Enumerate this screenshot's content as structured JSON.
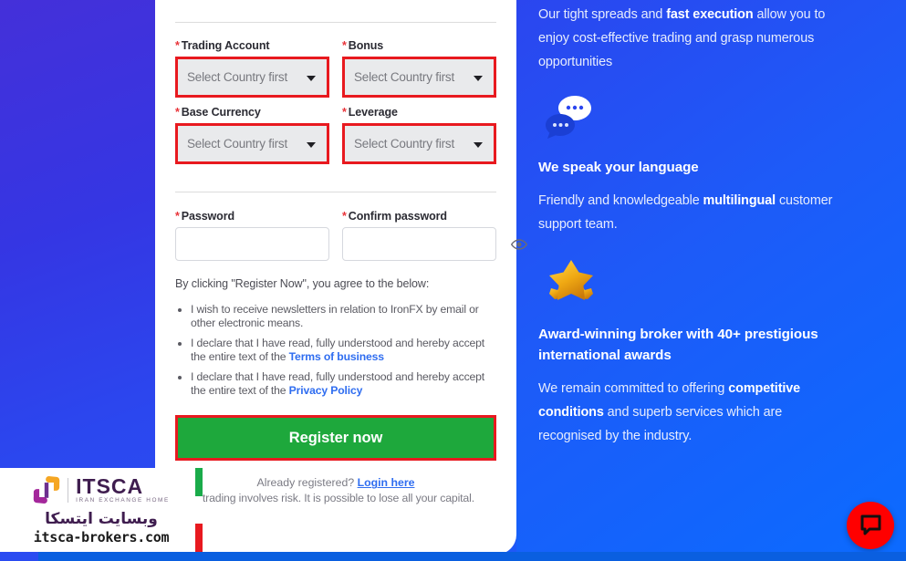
{
  "form": {
    "fields": [
      {
        "label": "Trading Account",
        "required": true,
        "value": "Select Country first",
        "name": "trading-account"
      },
      {
        "label": "Bonus",
        "required": true,
        "value": "Select Country first",
        "name": "bonus"
      },
      {
        "label": "Base Currency",
        "required": true,
        "value": "Select Country first",
        "name": "base-currency"
      },
      {
        "label": "Leverage",
        "required": true,
        "value": "Select Country first",
        "name": "leverage"
      }
    ],
    "password": {
      "label": "Password",
      "value": "",
      "placeholder": ""
    },
    "confirm_password": {
      "label": "Confirm password",
      "value": "",
      "placeholder": ""
    },
    "agree_intro": "By clicking \"Register Now\", you agree to the below:",
    "terms": [
      {
        "text": "I wish to receive newsletters in relation to IronFX by email or other electronic means.",
        "link": ""
      },
      {
        "text": "I declare that I have read, fully understood and hereby accept the entire text of the ",
        "link": "Terms of business"
      },
      {
        "text": "I declare that I have read, fully understood and hereby accept the entire text of the ",
        "link": "Privacy Policy"
      }
    ],
    "register_button": "Register now",
    "already_registered": "Already registered?",
    "login_link": "Login here",
    "risk_warning": "l trading involves risk. It is possible to lose all your capital.",
    "required_marker": "*"
  },
  "right_panel": {
    "intro_parts": [
      "Our tight spreads and ",
      "fast execution",
      " allow you to enjoy cost-effective trading and grasp numerous opportunities"
    ],
    "blocks": [
      {
        "icon": "chat-bubbles-icon",
        "heading": "We speak your language",
        "body_parts": [
          "Friendly and knowledgeable ",
          "multilingual",
          " customer support team."
        ]
      },
      {
        "icon": "award-stars-icon",
        "heading": "Award-winning broker with 40+ prestigious international awards",
        "body_parts": [
          "We remain committed to offering ",
          "competitive conditions",
          " and superb services which are recognised by the industry."
        ]
      }
    ]
  },
  "chat_widget": {
    "label": "chat-launcher",
    "color": "#ff0000"
  },
  "watermark": {
    "brand": "ITSCA",
    "tagline": "IRAN EXCHANGE HOME",
    "farsi": "وبسایت ایتسکا",
    "url": "itsca-brokers.com"
  },
  "colors": {
    "accent_red": "#e8191f",
    "register_green": "#1ea83c",
    "link_blue": "#2f6df0",
    "panel_blue": "#1b5ef5",
    "chat_red": "#ff0000"
  }
}
